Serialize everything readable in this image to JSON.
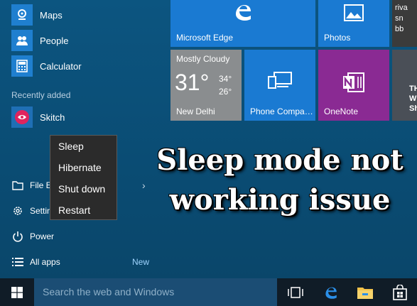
{
  "apps": {
    "maps": "Maps",
    "people": "People",
    "calculator": "Calculator",
    "recently_added_title": "Recently added",
    "skitch": "Skitch"
  },
  "system_items": {
    "file_explorer": "File Ex",
    "settings": "Settin",
    "power": "Power",
    "all_apps": "All apps",
    "new_badge": "New"
  },
  "power_menu": {
    "sleep": "Sleep",
    "hibernate": "Hibernate",
    "shut_down": "Shut down",
    "restart": "Restart"
  },
  "tiles": {
    "edge": "Microsoft Edge",
    "photos": "Photos",
    "news_text": "riva\nsn\nbb",
    "weather": {
      "condition": "Mostly Cloudy",
      "temp": "31°",
      "high": "34°",
      "low": "26°",
      "city": "New Delhi"
    },
    "phone": "Phone Compa…",
    "onenote": "OneNote",
    "side_text": "TH\nW\nSh"
  },
  "headline": {
    "line1": "Sleep mode not",
    "line2": "working issue"
  },
  "taskbar": {
    "search_placeholder": "Search the web and Windows"
  },
  "colors": {
    "accent_blue": "#1a7ad2",
    "onenote_purple": "#8a2a93",
    "weather_grey": "#8a8d8f",
    "taskbar": "#101c27",
    "search_box": "#1b4d74"
  }
}
